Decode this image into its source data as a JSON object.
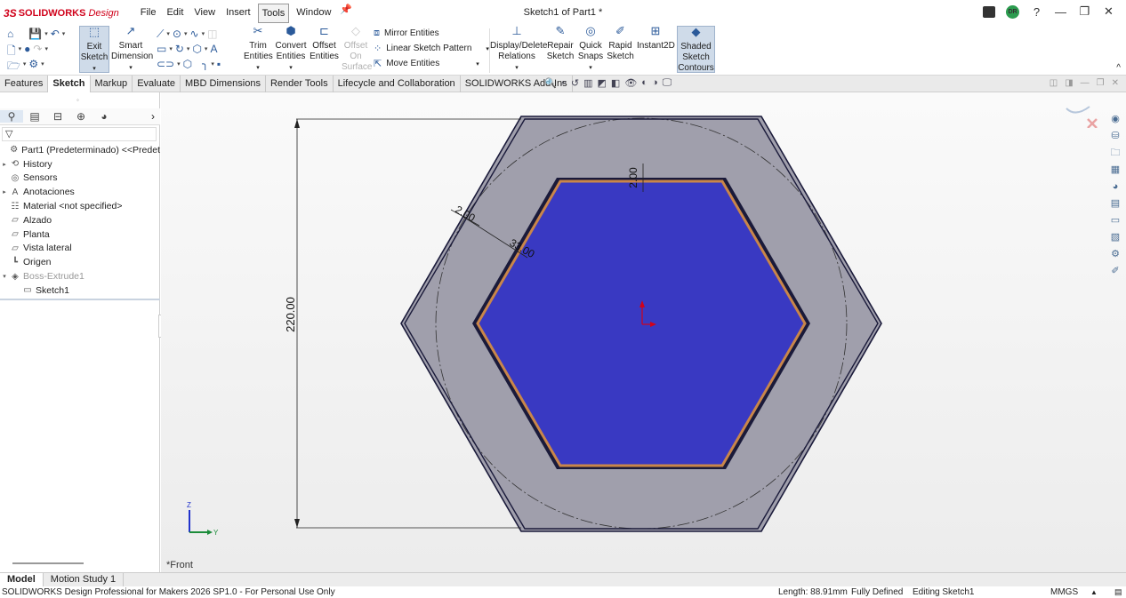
{
  "app": {
    "brand_prefix": "3S",
    "brand": "SOLIDWORKS",
    "brand_suffix": "Design",
    "doc_title": "Sketch1 of Part1 *",
    "avatar_initials": "DR"
  },
  "menu": [
    "File",
    "Edit",
    "View",
    "Insert",
    "Tools",
    "Window"
  ],
  "ribbon": {
    "exit_sketch": [
      "Exit",
      "Sketch"
    ],
    "smart_dimension": [
      "Smart",
      "Dimension"
    ],
    "trim_entities": [
      "Trim",
      "Entities"
    ],
    "convert_entities": [
      "Convert",
      "Entities"
    ],
    "offset_entities": [
      "Offset",
      "Entities"
    ],
    "offset_on_surface": [
      "Offset",
      "On",
      "Surface"
    ],
    "mirror_entities": "Mirror Entities",
    "linear_sketch_pattern": "Linear Sketch Pattern",
    "move_entities": "Move Entities",
    "display_delete_relations": [
      "Display/Delete",
      "Relations"
    ],
    "repair_sketch": [
      "Repair",
      "Sketch"
    ],
    "quick_snaps": [
      "Quick",
      "Snaps"
    ],
    "rapid_sketch": [
      "Rapid",
      "Sketch"
    ],
    "instant2d": "Instant2D",
    "shaded_sketch_contours": [
      "Shaded",
      "Sketch",
      "Contours"
    ]
  },
  "tabs": [
    "Features",
    "Sketch",
    "Markup",
    "Evaluate",
    "MBD Dimensions",
    "Render Tools",
    "Lifecycle and Collaboration",
    "SOLIDWORKS Add-Ins"
  ],
  "tree": [
    {
      "label": "Part1 (Predeterminado) <<Predet",
      "expander": "",
      "icon": "⚙"
    },
    {
      "label": "History",
      "expander": "▸",
      "icon": "⟲"
    },
    {
      "label": "Sensors",
      "expander": "",
      "icon": "◎"
    },
    {
      "label": "Anotaciones",
      "expander": "▸",
      "icon": "A"
    },
    {
      "label": "Material <not specified>",
      "expander": "",
      "icon": "☷"
    },
    {
      "label": "Alzado",
      "expander": "",
      "icon": "▱"
    },
    {
      "label": "Planta",
      "expander": "",
      "icon": "▱"
    },
    {
      "label": "Vista lateral",
      "expander": "",
      "icon": "▱"
    },
    {
      "label": "Origen",
      "expander": "",
      "icon": "┗"
    },
    {
      "label": "Boss-Extrude1",
      "expander": "▾",
      "icon": "◈"
    },
    {
      "label": "Sketch1",
      "expander": "",
      "icon": "▭"
    }
  ],
  "graphics": {
    "view_name": "*Front",
    "dimensions": {
      "height": "220.00",
      "top_gap": "2.00",
      "diag_gap": "2.00",
      "diag_width": "33.00"
    },
    "triad": {
      "z": "Z",
      "y": "Y"
    },
    "colors": {
      "outer_fill": "#a09fac",
      "inner_fill": "#3939c2",
      "inner_border": "#c9864a",
      "edge": "#1a1a3a"
    }
  },
  "bottom_tabs": [
    "Model",
    "Motion Study 1"
  ],
  "status": {
    "product": "SOLIDWORKS Design Professional for Makers 2026 SP1.0 - For Personal Use Only",
    "length": "Length: 88.91mm",
    "definition": "Fully Defined",
    "mode": "Editing Sketch1",
    "units": "MMGS"
  }
}
